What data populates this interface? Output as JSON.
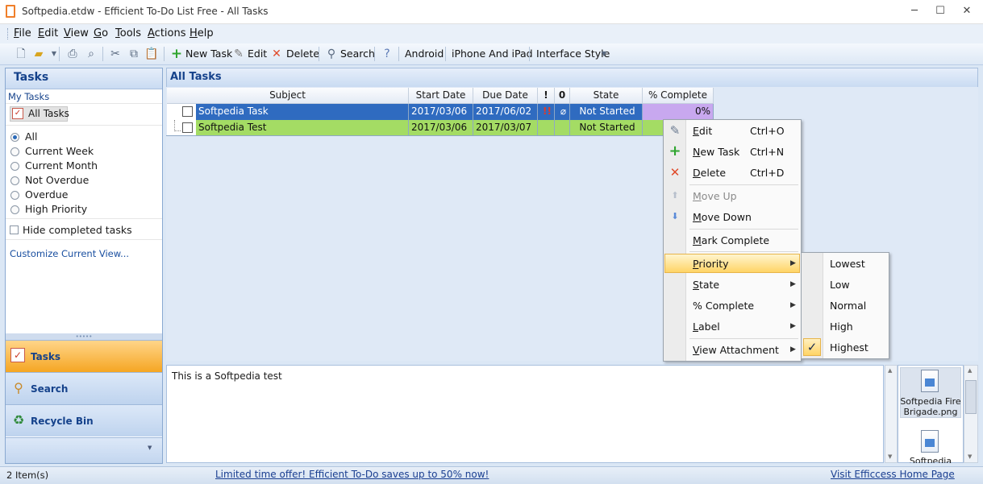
{
  "window": {
    "title": "Softpedia.etdw - Efficient To-Do List Free - All Tasks",
    "minimize": "─",
    "maximize": "☐",
    "close": "✕"
  },
  "menu": [
    "File",
    "Edit",
    "View",
    "Go",
    "Tools",
    "Actions",
    "Help"
  ],
  "toolbar": {
    "new_task": "New Task",
    "edit": "Edit",
    "delete": "Delete",
    "search": "Search",
    "android": "Android",
    "iphone": "iPhone And iPad",
    "interface_style": "Interface Style"
  },
  "sidebar": {
    "title": "Tasks",
    "my_tasks": "My Tasks",
    "all_tasks": "All Tasks",
    "filters": [
      {
        "label": "All",
        "selected": true
      },
      {
        "label": "Current Week",
        "selected": false
      },
      {
        "label": "Current Month",
        "selected": false
      },
      {
        "label": "Not Overdue",
        "selected": false
      },
      {
        "label": "Overdue",
        "selected": false
      },
      {
        "label": "High Priority",
        "selected": false
      }
    ],
    "hide_completed": "Hide completed tasks",
    "customize": "Customize Current View...",
    "nav": [
      {
        "label": "Tasks",
        "active": true
      },
      {
        "label": "Search",
        "active": false
      },
      {
        "label": "Recycle Bin",
        "active": false
      }
    ]
  },
  "main": {
    "title": "All Tasks",
    "columns": [
      "Subject",
      "Start Date",
      "Due Date",
      "!",
      "0",
      "State",
      "% Complete"
    ],
    "rows": [
      {
        "subject": "Softpedia Task",
        "start": "2017/03/06",
        "due": "2017/06/02",
        "state": "Not Started",
        "complete": "0%",
        "color": "#2f6bc0"
      },
      {
        "subject": "Softpedia Test",
        "start": "2017/03/06",
        "due": "2017/03/07",
        "state": "Not Started",
        "complete": "",
        "color": "#a4dc64"
      }
    ],
    "notes": "This is a Softpedia test",
    "attachments": [
      "Softpedia Fire Brigade.png",
      "Softpedia"
    ]
  },
  "context_menu": {
    "items": [
      {
        "label": "Edit",
        "shortcut": "Ctrl+O"
      },
      {
        "label": "New Task",
        "shortcut": "Ctrl+N"
      },
      {
        "label": "Delete",
        "shortcut": "Ctrl+D"
      },
      {
        "label": "Move Up",
        "disabled": true
      },
      {
        "label": "Move Down"
      },
      {
        "label": "Mark Complete"
      },
      {
        "label": "Priority",
        "submenu": true
      },
      {
        "label": "State",
        "submenu": true
      },
      {
        "label": "% Complete",
        "submenu": true
      },
      {
        "label": "Label",
        "submenu": true
      },
      {
        "label": "View Attachment",
        "submenu": true
      }
    ],
    "priority_submenu": [
      "Lowest",
      "Low",
      "Normal",
      "High",
      "Highest"
    ],
    "priority_checked": "Highest"
  },
  "status": {
    "count": "2 Item(s)",
    "offer": "Limited time offer! Efficient To-Do saves up to 50% now!",
    "home": "Visit Efficcess Home Page"
  }
}
